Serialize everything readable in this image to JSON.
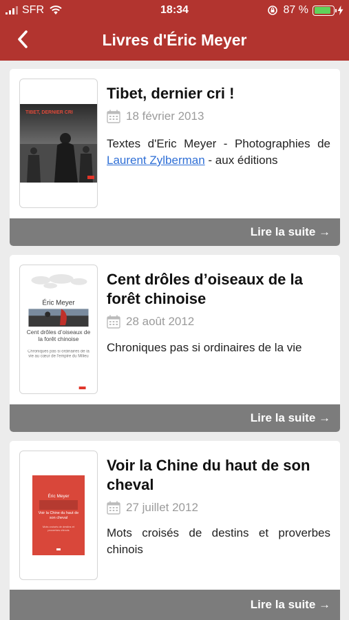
{
  "status_bar": {
    "carrier": "SFR",
    "time": "18:34",
    "battery_percent": "87 %",
    "battery_level": 0.87
  },
  "nav": {
    "title": "Livres d'Éric Meyer",
    "back_icon": "chevron-left-icon"
  },
  "books": [
    {
      "title": "Tibet, dernier cri !",
      "date": "18 février 2013",
      "excerpt_before": "Textes d'Eric Meyer - Photographies de ",
      "excerpt_link": "Laurent Zylberman",
      "excerpt_after": " - aux éditions",
      "read_more": "Lire la suite →",
      "cover": {
        "title": "TIBET, DERNIER CRI"
      }
    },
    {
      "title": "Cent drôles d’oiseaux de la forêt chinoise",
      "date": "28 août 2012",
      "excerpt": "Chroniques pas si ordinaires de la vie",
      "read_more": "Lire la suite →",
      "cover": {
        "author": "Éric Meyer",
        "title": "Cent drôles d’oiseaux de la forêt chinoise",
        "subtitle": "Chroniques pas si ordinaires de la vie au cœur de l’empire du Milieu"
      }
    },
    {
      "title": "Voir la Chine du haut de son cheval",
      "date": "27 juillet 2012",
      "excerpt": "Mots croisés de destins et proverbes chinois",
      "read_more": "Lire la suite →",
      "cover": {
        "author": "Éric Meyer",
        "title": "Voir la Chine du haut de son cheval",
        "subtitle": "Mots croisés de destins et proverbes chinois"
      }
    }
  ],
  "colors": {
    "brand_red": "#b2342f",
    "read_more_bar": "#7c7c7c",
    "link": "#2f6fd6",
    "battery_green": "#5fd35a"
  }
}
